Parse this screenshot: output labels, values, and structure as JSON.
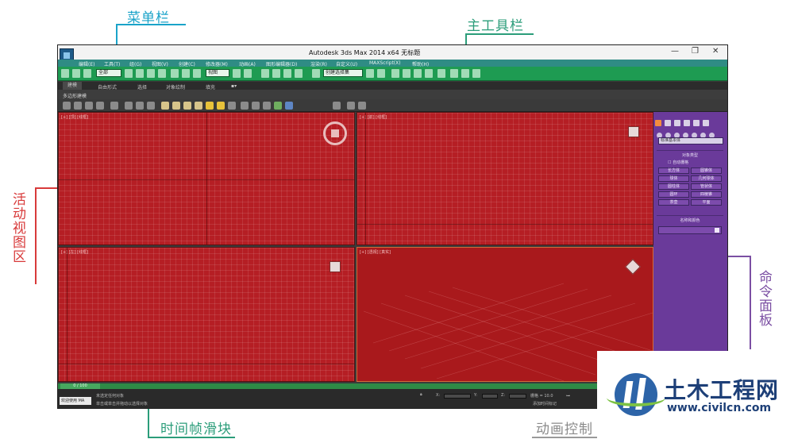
{
  "annotations": {
    "menubar": "菜单栏",
    "main_toolbar": "主工具栏",
    "viewport_area": "活动视图区",
    "command_panel": "命令面板",
    "time_slider": "时间帧滑块",
    "anim_controls": "动画控制"
  },
  "app": {
    "title": "Autodesk 3ds Max  2014 x64    无标题",
    "window_buttons": [
      "—",
      "❐",
      "✕"
    ],
    "menu_items": [
      "编辑(E)",
      "工具(T)",
      "组(G)",
      "视图(V)",
      "创建(C)",
      "修改器(M)",
      "动画(A)",
      "图形编辑器(D)",
      "渲染(R)",
      "自定义(U)",
      "MAXScript(X)",
      "帮助(H)"
    ],
    "toolbar": {
      "selection_filter": "全部",
      "ref_coord": "视图",
      "named_selection": "创建选择集"
    },
    "ribbon_tabs": [
      "建模",
      "自由形式",
      "选择",
      "对象绘制",
      "填充"
    ],
    "ribbon_sub": "多边形建模",
    "viewports": [
      {
        "label": "[+] [顶] [线框]"
      },
      {
        "label": "[+] [前] [线框]"
      },
      {
        "label": "[+] [左] [线框]"
      },
      {
        "label": "[+] [透视] [真实]"
      }
    ],
    "command_panel": {
      "dropdown": "标准基本体",
      "object_type_header": "对象类型",
      "autogrid": "自动栅格",
      "buttons": [
        "长方体",
        "圆锥体",
        "球体",
        "几何球体",
        "圆柱体",
        "管状体",
        "圆环",
        "四棱锥",
        "茶壶",
        "平面"
      ],
      "name_color_header": "名称和颜色"
    },
    "time_slider": {
      "value": "0 / 100"
    },
    "status": {
      "welcome": "欢迎使用 MA",
      "line1": "未选定任何对象",
      "line2": "单击或单击并拖动以选择对象",
      "grid": "栅格 = 10.0",
      "add_time_tag": "添加时间标记",
      "coords": [
        "X:",
        "Y:",
        "Z:"
      ]
    }
  },
  "watermark": {
    "name": "土木工程网",
    "url": "www.civilcn.com"
  },
  "colors": {
    "menubar_highlight": "#2f8c84",
    "toolbar_highlight": "#1e9b52",
    "viewport_highlight": "#b51e24",
    "command_panel_highlight": "#6a3a9a",
    "timebar_highlight": "#2e8a46"
  }
}
